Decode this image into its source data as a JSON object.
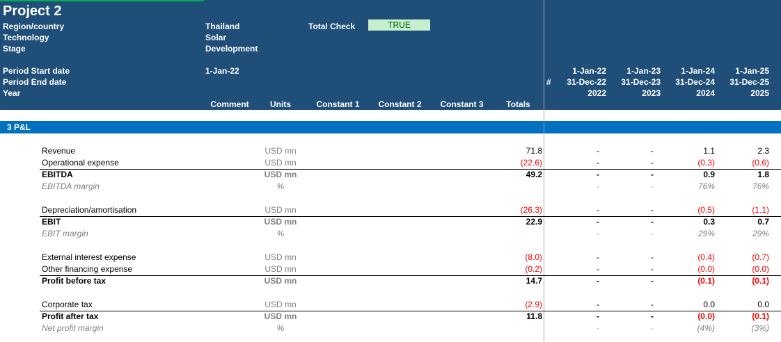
{
  "sheet": {
    "title": "Project 2",
    "meta": [
      {
        "label": "Region/country",
        "value": "Thailand"
      },
      {
        "label": "Technology",
        "value": "Solar"
      },
      {
        "label": "Stage",
        "value": "Development"
      }
    ],
    "check_label": "Total Check",
    "check_value": "TRUE",
    "period_start_label": "Period Start date",
    "period_start_value": "1-Jan-22",
    "period_end_label": "Period End date",
    "year_label": "Year",
    "hash": "#",
    "columns": {
      "comment": "Comment",
      "units": "Units",
      "constant1": "Constant 1",
      "constant2": "Constant 2",
      "constant3": "Constant 3",
      "totals": "Totals"
    },
    "periods": [
      {
        "start": "1-Jan-22",
        "end": "31-Dec-22",
        "year": "2022"
      },
      {
        "start": "1-Jan-23",
        "end": "31-Dec-23",
        "year": "2023"
      },
      {
        "start": "1-Jan-24",
        "end": "31-Dec-24",
        "year": "2024"
      },
      {
        "start": "1-Jan-25",
        "end": "31-Dec-25",
        "year": "2025"
      }
    ],
    "section": "3 P&L",
    "rows": [
      {
        "label": "Revenue",
        "units": "USD mn",
        "total": "71.8",
        "p": [
          "-",
          "-",
          "1.1",
          "2.3"
        ],
        "style": "normal",
        "total_neg": false,
        "neg": [
          false,
          false,
          false,
          false
        ]
      },
      {
        "label": "Operational expense",
        "units": "USD mn",
        "total": "(22.6)",
        "p": [
          "-",
          "-",
          "(0.3)",
          "(0.6)"
        ],
        "style": "normal",
        "total_neg": true,
        "neg": [
          false,
          false,
          true,
          true
        ]
      },
      {
        "label": "EBITDA",
        "units": "USD mn",
        "total": "49.2",
        "p": [
          "-",
          "-",
          "0.9",
          "1.8"
        ],
        "style": "bold",
        "total_neg": false,
        "neg": [
          false,
          false,
          false,
          false
        ]
      },
      {
        "label": "EBITDA margin",
        "units": "%",
        "total": "",
        "p": [
          "-",
          "-",
          "76%",
          "76%"
        ],
        "style": "italic",
        "total_neg": false,
        "neg": [
          false,
          false,
          false,
          false
        ]
      },
      {
        "label": "Depreciation/amortisation",
        "units": "USD mn",
        "total": "(26.3)",
        "p": [
          "-",
          "-",
          "(0.5)",
          "(1.1)"
        ],
        "style": "normal",
        "total_neg": true,
        "neg": [
          false,
          false,
          true,
          true
        ]
      },
      {
        "label": "EBIT",
        "units": "USD mn",
        "total": "22.9",
        "p": [
          "-",
          "-",
          "0.3",
          "0.7"
        ],
        "style": "bold",
        "total_neg": false,
        "neg": [
          false,
          false,
          false,
          false
        ]
      },
      {
        "label": "EBIT margin",
        "units": "%",
        "total": "",
        "p": [
          "-",
          "-",
          "29%",
          "29%"
        ],
        "style": "italic",
        "total_neg": false,
        "neg": [
          false,
          false,
          false,
          false
        ]
      },
      {
        "label": "External interest expense",
        "units": "USD mn",
        "total": "(8.0)",
        "p": [
          "-",
          "-",
          "(0.4)",
          "(0.7)"
        ],
        "style": "normal",
        "total_neg": true,
        "neg": [
          false,
          false,
          true,
          true
        ]
      },
      {
        "label": "Other financing expense",
        "units": "USD mn",
        "total": "(0.2)",
        "p": [
          "-",
          "-",
          "(0.0)",
          "(0.0)"
        ],
        "style": "normal",
        "total_neg": true,
        "neg": [
          false,
          false,
          true,
          true
        ]
      },
      {
        "label": "Profit before tax",
        "units": "USD mn",
        "total": "14.7",
        "p": [
          "-",
          "-",
          "(0.1)",
          "(0.1)"
        ],
        "style": "bold",
        "total_neg": false,
        "neg": [
          false,
          false,
          true,
          true
        ]
      },
      {
        "label": "Corporate tax",
        "units": "USD mn",
        "total": "(2.9)",
        "p": [
          "-",
          "-",
          "0.0",
          "0.0"
        ],
        "style": "normal",
        "total_neg": true,
        "neg": [
          false,
          false,
          false,
          false
        ]
      },
      {
        "label": "Profit after tax",
        "units": "USD mn",
        "total": "11.8",
        "p": [
          "-",
          "-",
          "(0.0)",
          "(0.1)"
        ],
        "style": "bold",
        "total_neg": false,
        "neg": [
          false,
          false,
          true,
          true
        ]
      },
      {
        "label": "Net profit margin",
        "units": "%",
        "total": "",
        "p": [
          "-",
          "-",
          "(4%)",
          "(3%)"
        ],
        "style": "italic",
        "total_neg": false,
        "neg": [
          false,
          false,
          false,
          false
        ]
      }
    ]
  }
}
